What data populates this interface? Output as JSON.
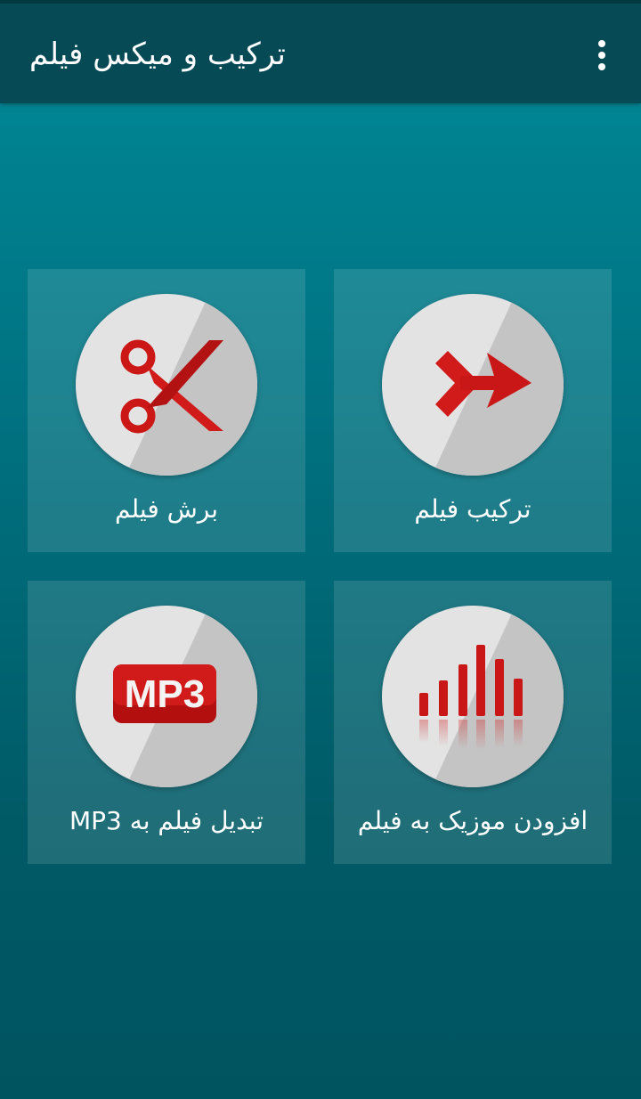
{
  "app": {
    "title": "ترکیب و میکس فیلم"
  },
  "menu": {
    "icon": "overflow-menu-icon"
  },
  "tiles": [
    {
      "id": "cut",
      "label": "برش فیلم",
      "icon": "scissors-icon"
    },
    {
      "id": "merge",
      "label": "ترکیب فیلم",
      "icon": "merge-arrow-icon"
    },
    {
      "id": "mp3",
      "label": "تبدیل فیلم به MP3",
      "icon": "mp3-icon",
      "icon_text": "MP3"
    },
    {
      "id": "music",
      "label": "افزودن موزیک به فیلم",
      "icon": "audio-bars-icon"
    }
  ],
  "colors": {
    "appbar": "#064a56",
    "background_top": "#008a99",
    "background_bottom": "#005460",
    "accent_red": "#d11a1a",
    "circle_light": "#e3e3e3",
    "circle_shade": "#c4c4c4"
  }
}
